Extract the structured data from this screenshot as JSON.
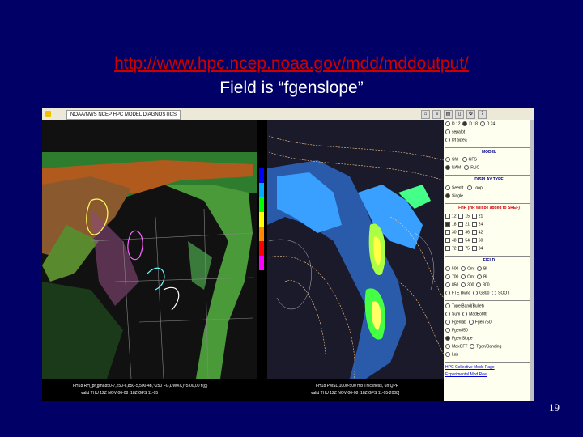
{
  "slide": {
    "url": "http://www.hpc.ncep.noaa.gov/mdd/mddoutput/",
    "subtitle": "Field is “fgenslope”",
    "number": "19"
  },
  "browser": {
    "tab_title": "NOAA/NWS NCEP HPC MODEL DIAGNOSTICS"
  },
  "maps": {
    "left_caption_1": "FH18 RH_pr(gma850-7,250-6,850-5,500-4b,~250 FG,DWXC)~5,00,00 fi(g)",
    "left_caption_2": "valid THU 12Z NOV-06-08 [18Z GFS 11-05",
    "right_caption_1": "FH18 PMSL,1000-500 mb Thickness, 6h QPF",
    "right_caption_2": "valid THU 12Z NOV-06-08 [18Z GFS 11-05-2008]"
  },
  "panel": {
    "top_opts": [
      "D 12",
      "D 18",
      "D 24"
    ],
    "opt_sepalot": "sepalot",
    "opt_dotypes": "Dt typea",
    "model_header": "MODEL",
    "model_opts": [
      "Sfcl",
      "GFS",
      "NAM",
      "RUC"
    ],
    "display_header": "DISPLAY TYPE",
    "display_opts": [
      "Seemt",
      "Loop",
      "Single"
    ],
    "fhr_header": "FHR (HR will be added to SREF)",
    "fhr_rows": [
      [
        "12",
        "15",
        "21"
      ],
      [
        "18",
        "21",
        "24"
      ],
      [
        "30",
        "36",
        "42"
      ],
      [
        "48",
        "54",
        "60"
      ],
      [
        "72",
        "75",
        "84"
      ]
    ],
    "field_header": "FIELD",
    "field_opts": [
      [
        "500",
        "Cmt",
        "Bl"
      ],
      [
        "700",
        "Cmt",
        "Bl"
      ],
      [
        "850",
        "300",
        "300"
      ],
      [
        "FTE Bwnd",
        "G300",
        "SOOT"
      ]
    ],
    "list_opts": [
      "Type/Band(Bullet)",
      "Sum",
      "MadBoMtr",
      "Fgenlab",
      "Fgen750",
      "Fgen850",
      "Fgen Slope",
      "MaxGFT",
      "Tgen/Banding",
      "Lab"
    ],
    "links": [
      "HPC Collective Mode Page",
      "Experimental Mod Reel"
    ]
  }
}
